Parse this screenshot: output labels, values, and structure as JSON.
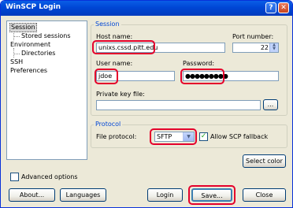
{
  "window": {
    "title": "WinSCP Login"
  },
  "titlebar": {
    "help": "?",
    "close": "✕"
  },
  "tree": {
    "items": [
      {
        "label": "Session",
        "selected": true
      },
      {
        "label": "Stored sessions"
      },
      {
        "label": "Environment"
      },
      {
        "label": "Directories"
      },
      {
        "label": "SSH"
      },
      {
        "label": "Preferences"
      }
    ]
  },
  "session": {
    "legend": "Session",
    "host_label": "Host name:",
    "host_value": "unixs.cssd.pitt.edu",
    "port_label": "Port number:",
    "port_value": "22",
    "user_label": "User name:",
    "user_value": "jdoe",
    "password_label": "Password:",
    "password_value": "●●●●●●●●●",
    "key_label": "Private key file:",
    "key_value": "",
    "browse_label": "..."
  },
  "protocol": {
    "legend": "Protocol",
    "file_protocol_label": "File protocol:",
    "file_protocol_value": "SFTP",
    "scp_fallback_label": "Allow SCP fallback",
    "scp_fallback_checked": true
  },
  "buttons": {
    "select_color": "Select color",
    "advanced_options": "Advanced options",
    "about": "About...",
    "languages": "Languages",
    "login": "Login",
    "save": "Save...",
    "close": "Close"
  },
  "colors": {
    "titlebar": "#0046d5",
    "highlight": "#e4002b",
    "legend": "#0046d5"
  }
}
